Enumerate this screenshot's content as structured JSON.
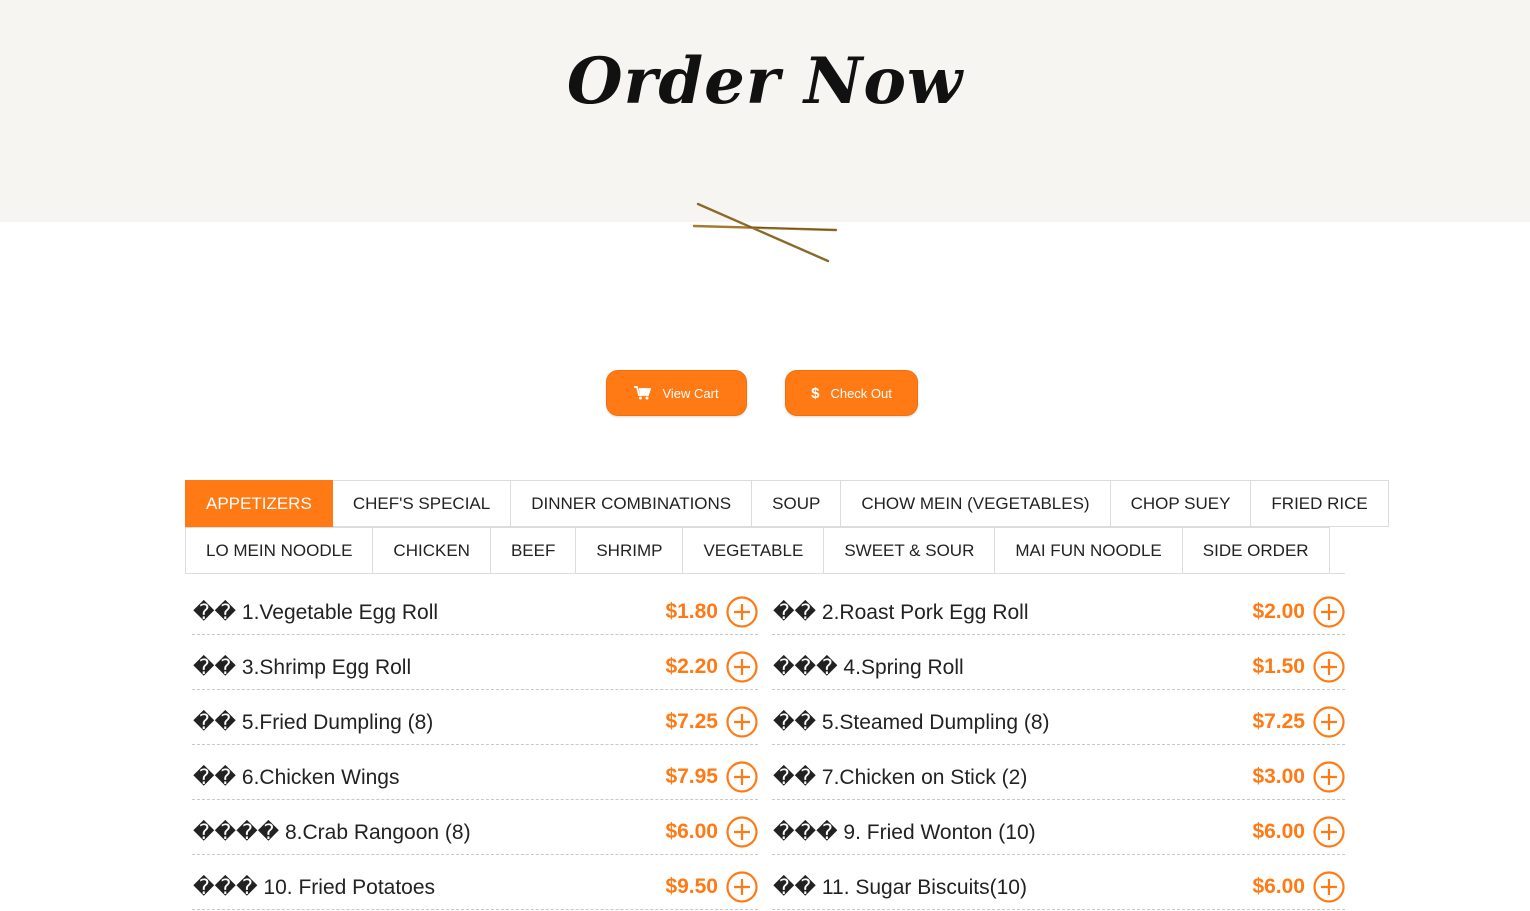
{
  "hero": {
    "title": "Order Now"
  },
  "actions": {
    "view_cart_label": "View Cart",
    "checkout_label": "Check Out",
    "accent_color": "#ff7a14"
  },
  "tabs": {
    "row1": [
      "APPETIZERS",
      "CHEF'S SPECIAL",
      "DINNER COMBINATIONS",
      "SOUP",
      "CHOW MEIN (VEGETABLES)",
      "CHOP SUEY",
      "FRIED RICE"
    ],
    "row2": [
      "LO MEIN NOODLE",
      "CHICKEN",
      "BEEF",
      "SHRIMP",
      "VEGETABLE",
      "SWEET & SOUR",
      "MAI FUN NOODLE",
      "SIDE ORDER"
    ],
    "active": "APPETIZERS"
  },
  "menu": {
    "items": [
      {
        "name": "�� 1.Vegetable Egg Roll",
        "price": "$1.80"
      },
      {
        "name": "�� 2.Roast Pork Egg Roll",
        "price": "$2.00"
      },
      {
        "name": "�� 3.Shrimp Egg Roll",
        "price": "$2.20"
      },
      {
        "name": "��� 4.Spring Roll",
        "price": "$1.50"
      },
      {
        "name": "�� 5.Fried Dumpling (8)",
        "price": "$7.25"
      },
      {
        "name": "�� 5.Steamed Dumpling (8)",
        "price": "$7.25"
      },
      {
        "name": "�� 6.Chicken Wings",
        "price": "$7.95"
      },
      {
        "name": "�� 7.Chicken on Stick (2)",
        "price": "$3.00"
      },
      {
        "name": "���� 8.Crab Rangoon (8)",
        "price": "$6.00"
      },
      {
        "name": "��� 9. Fried Wonton (10)",
        "price": "$6.00"
      },
      {
        "name": "��� 10. Fried Potatoes",
        "price": "$9.50"
      },
      {
        "name": "�� 11. Sugar Biscuits(10)",
        "price": "$6.00"
      }
    ],
    "add_icon": "plus-circle-icon"
  }
}
